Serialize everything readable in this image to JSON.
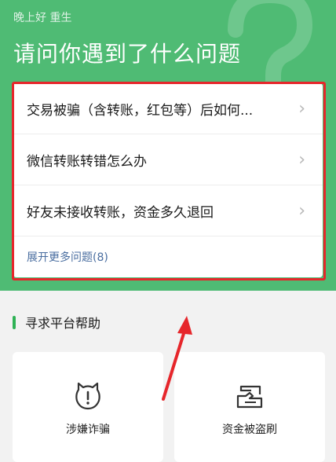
{
  "header": {
    "greeting": "晚上好 重生",
    "title": "请问你遇到了什么问题",
    "background_color": "#4fbb74"
  },
  "questions": [
    {
      "label": "交易被骗（含转账，红包等）后如何..."
    },
    {
      "label": "微信转账转错怎么办"
    },
    {
      "label": "好友未接收转账，资金多久退回"
    }
  ],
  "more_questions": "展开更多问题(8)",
  "help_section": {
    "title": "寻求平台帮助",
    "tiles": [
      {
        "label": "涉嫌诈骗",
        "icon": "fraud-alert-icon"
      },
      {
        "label": "资金被盗刷",
        "icon": "card-theft-icon"
      }
    ]
  },
  "annotation_color": "#e6262b"
}
